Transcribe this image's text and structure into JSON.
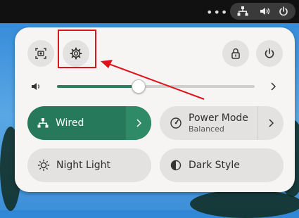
{
  "quick_settings": {
    "wired_label": "Wired",
    "power_mode_label": "Power Mode",
    "power_mode_value": "Balanced",
    "night_light_label": "Night Light",
    "dark_style_label": "Dark Style"
  },
  "volume": {
    "level_fraction": 0.41
  },
  "colors": {
    "accent": "#26795a",
    "highlight_box": "#e0121b",
    "panel_bg": "#f6f5f4",
    "topbar_bg": "#111111"
  },
  "icons": [
    "network-icon",
    "volume-icon",
    "power-icon",
    "screenshot-icon",
    "settings-icon",
    "lock-icon",
    "speaker-icon",
    "chevron-right-icon",
    "gauge-icon",
    "sun-icon",
    "contrast-icon"
  ]
}
